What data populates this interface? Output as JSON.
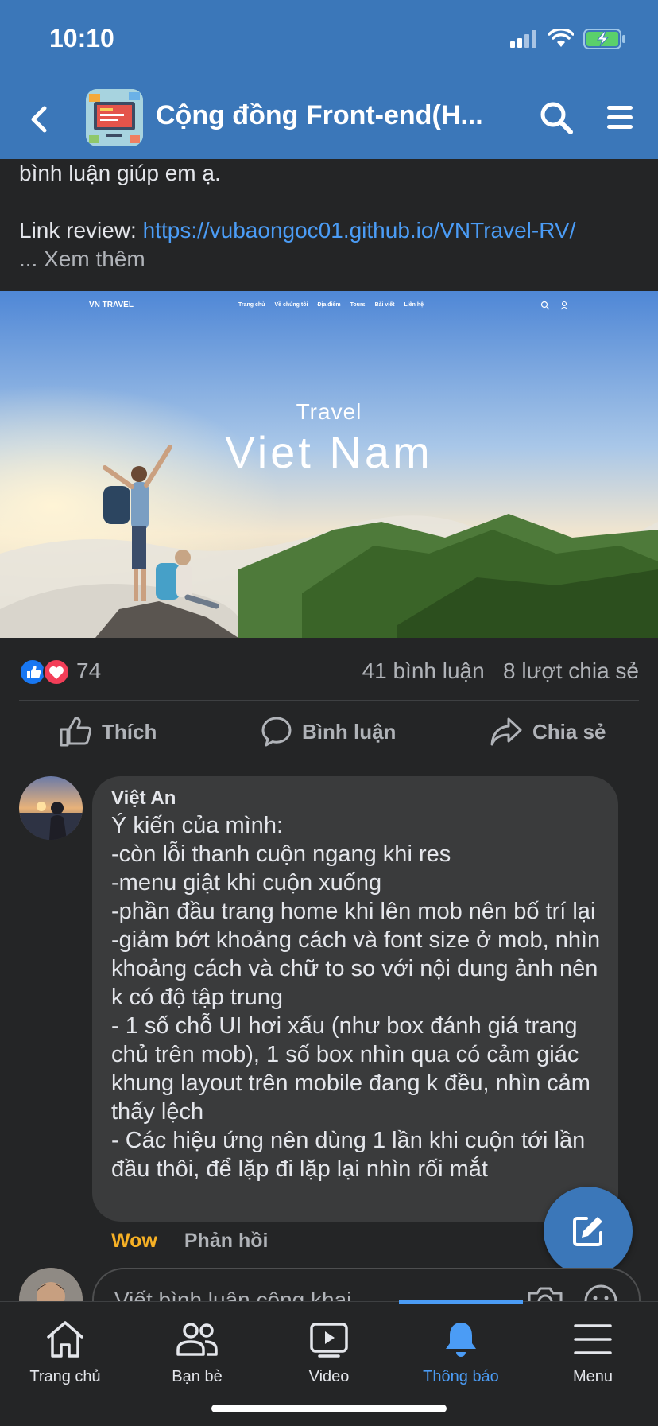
{
  "status_bar": {
    "time": "10:10"
  },
  "nav": {
    "title": "Cộng đồng Front-end(H..."
  },
  "post": {
    "text_line1": "bình luận giúp em ạ.",
    "link_label": "Link review: ",
    "link_url": "https://vubaongoc01.github.io/VNTravel-RV/",
    "see_more": "... Xem thêm"
  },
  "banner": {
    "logo": "VN TRAVEL",
    "links": [
      "Trang chủ",
      "Về chúng tôi",
      "Địa điểm",
      "Tours",
      "Bài viết",
      "Liên hệ"
    ],
    "subtitle": "Travel",
    "title": "Viet Nam"
  },
  "stats": {
    "reactions": "74",
    "comments": "41 bình luận",
    "shares": "8 lượt chia sẻ"
  },
  "actions": {
    "like": "Thích",
    "comment": "Bình luận",
    "share": "Chia sẻ"
  },
  "comment": {
    "author": "Việt An",
    "lines": [
      "Ý kiến của mình:",
      "-còn lỗi thanh cuộn ngang khi res",
      "-menu giật khi cuộn xuống",
      "-phần đầu trang home khi lên mob nên bố trí lại",
      "-giảm bớt khoảng cách và font size ở mob, nhìn khoảng cách và chữ to so với nội dung ảnh nên k có độ tập trung",
      "- 1 số chỗ UI hơi xấu (như box đánh giá trang chủ trên mob), 1 số box nhìn qua có cảm giác khung layout trên mobile đang k đều, nhìn cảm thấy lệch",
      "- Các hiệu ứng nên dùng 1 lần khi cuộn tới lần đầu thôi, để lặp đi lặp lại nhìn rối mắt"
    ],
    "reaction_label": "Wow",
    "reply_label": "Phản hồi"
  },
  "composer": {
    "placeholder": "Viết bình luận công khai..."
  },
  "tabs": [
    {
      "label": "Trang chủ"
    },
    {
      "label": "Bạn bè"
    },
    {
      "label": "Video"
    },
    {
      "label": "Thông báo"
    },
    {
      "label": "Menu"
    }
  ],
  "colors": {
    "header": "#3b77b9",
    "background": "#242526",
    "link": "#4b9cf5",
    "wow": "#f7b125"
  }
}
